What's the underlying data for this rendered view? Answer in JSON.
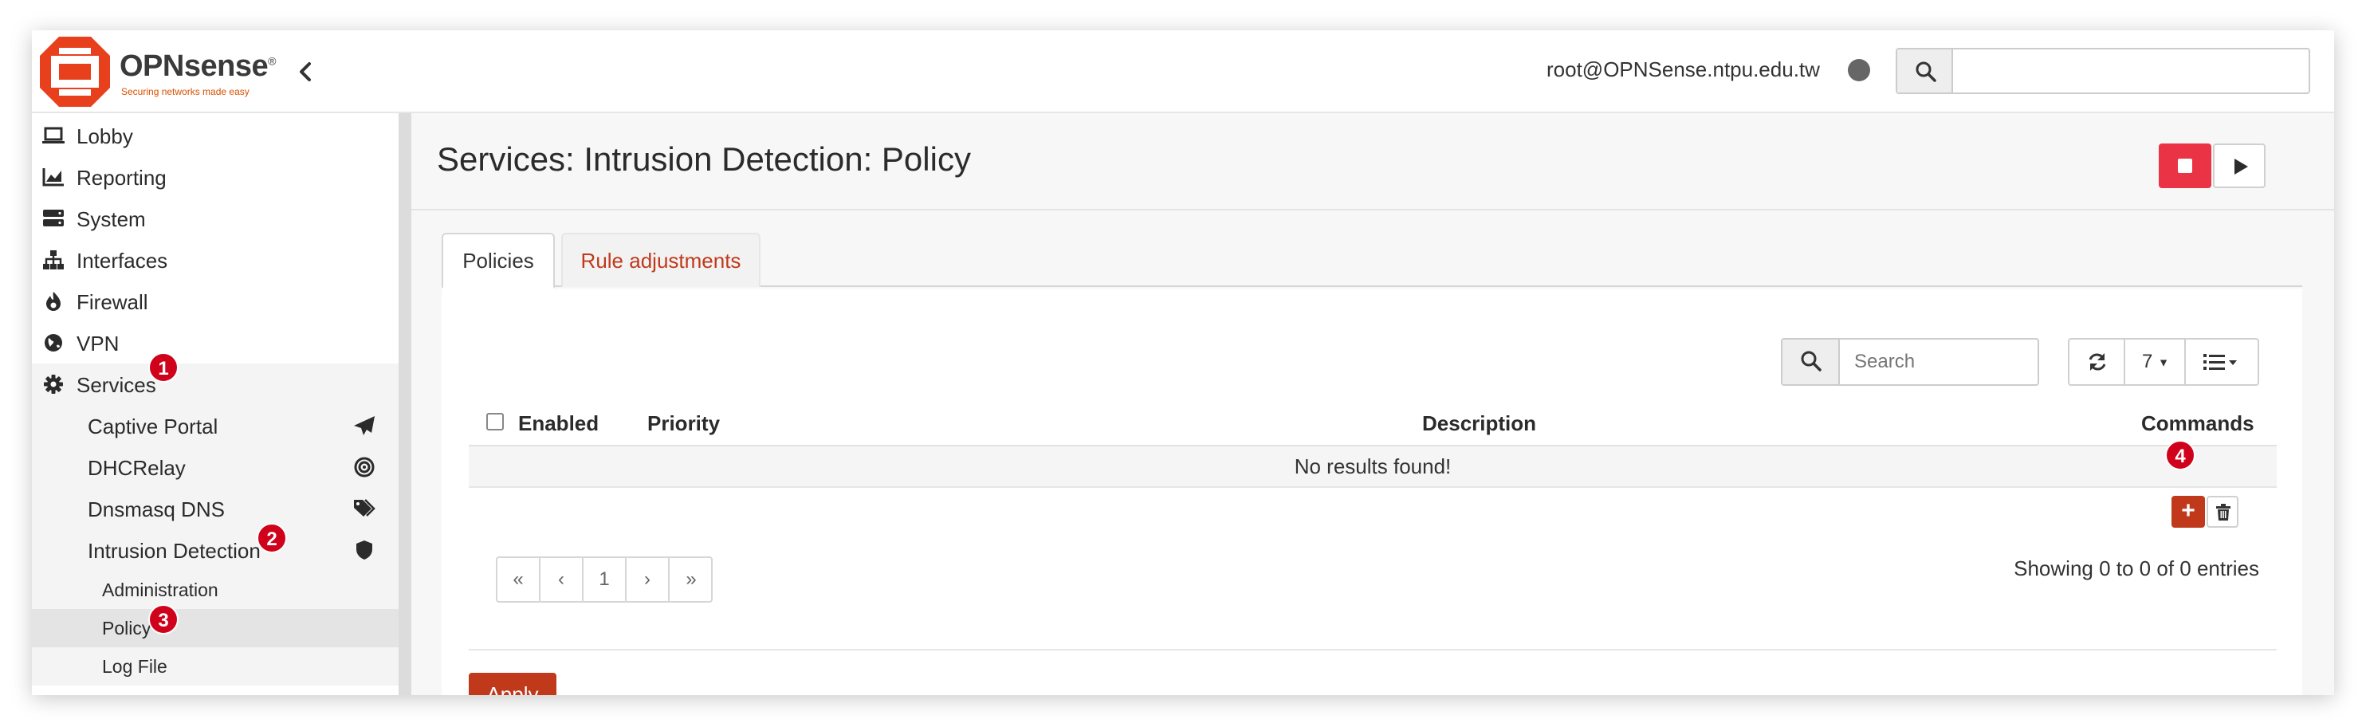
{
  "header": {
    "brand": "OPNsense",
    "brand_mark": "®",
    "tagline": "Securing networks made easy",
    "user": "root@OPNSense.ntpu.edu.tw",
    "search_placeholder": "",
    "icons": [
      "chevron-left-icon",
      "status-dot-icon",
      "search-icon"
    ]
  },
  "sidebar": {
    "items": [
      {
        "label": "Lobby",
        "icon": "laptop-icon"
      },
      {
        "label": "Reporting",
        "icon": "chart-icon"
      },
      {
        "label": "System",
        "icon": "server-icon"
      },
      {
        "label": "Interfaces",
        "icon": "sitemap-icon"
      },
      {
        "label": "Firewall",
        "icon": "fire-icon"
      },
      {
        "label": "VPN",
        "icon": "globe-icon"
      },
      {
        "label": "Services",
        "icon": "gear-icon"
      }
    ],
    "services_children": [
      {
        "label": "Captive Portal",
        "icon": "paper-plane-icon"
      },
      {
        "label": "DHCRelay",
        "icon": "bullseye-icon"
      },
      {
        "label": "Dnsmasq DNS",
        "icon": "tags-icon"
      },
      {
        "label": "Intrusion Detection",
        "icon": "shield-icon"
      }
    ],
    "ids_children": [
      {
        "label": "Administration"
      },
      {
        "label": "Policy"
      },
      {
        "label": "Log File"
      }
    ],
    "active_item": "Policy"
  },
  "badges": [
    "1",
    "2",
    "3",
    "4"
  ],
  "page": {
    "title": "Services: Intrusion Detection: Policy",
    "tabs": [
      {
        "label": "Policies",
        "active": true
      },
      {
        "label": "Rule adjustments",
        "active": false
      }
    ]
  },
  "grid": {
    "search_placeholder": "Search",
    "row_count": "7",
    "columns": [
      "Enabled",
      "Priority",
      "Description",
      "Commands"
    ],
    "empty_message": "No results found!",
    "pagination": [
      "«",
      "‹",
      "1",
      "›",
      "»"
    ],
    "entries_info": "Showing 0 to 0 of 0 entries",
    "add_label": "+",
    "apply_label": "Apply"
  },
  "colors": {
    "accent": "#c0391b",
    "stop": "#ea3345",
    "badge": "#d0021b",
    "logo": "#e8401c"
  }
}
